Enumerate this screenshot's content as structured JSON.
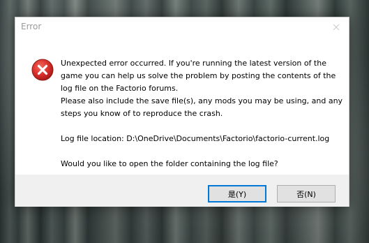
{
  "dialog": {
    "title": "Error",
    "icon": "error-x-icon",
    "message": {
      "line1": "Unexpected error occurred. If you're running the latest version of the game you can help us solve the problem by posting the contents of the log file on the Factorio forums.",
      "line2": "Please also include the save file(s), any mods you may be using, and any steps you know of to reproduce the crash.",
      "log_location": "Log file location: D:\\OneDrive\\Documents\\Factorio\\factorio-current.log",
      "question": "Would you like to open the folder containing the log file?"
    },
    "buttons": {
      "yes_label": "是(Y)",
      "no_label": "否(N)"
    }
  },
  "colors": {
    "error_red": "#d9302c",
    "focus_border": "#0078d7",
    "footer_bg": "#f0f0f0"
  }
}
